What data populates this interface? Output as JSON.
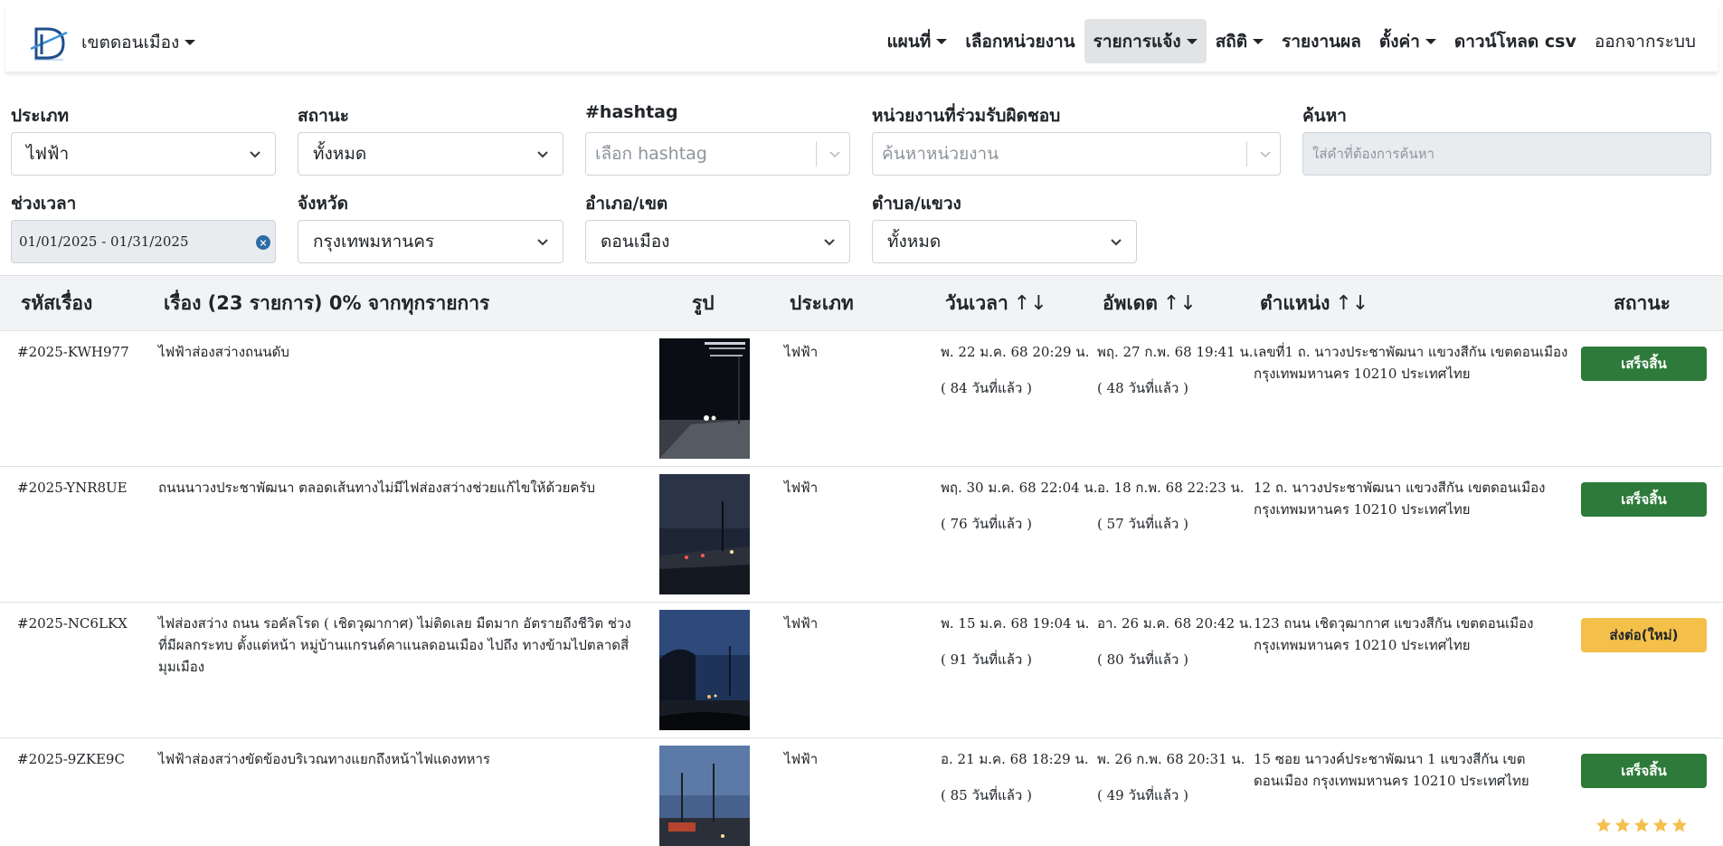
{
  "brand": {
    "district": "เขตดอนเมือง"
  },
  "nav": [
    {
      "label": "แผนที่",
      "dropdown": true,
      "active": false
    },
    {
      "label": "เลือกหน่วยงาน",
      "dropdown": false,
      "active": false
    },
    {
      "label": "รายการแจ้ง",
      "dropdown": true,
      "active": true
    },
    {
      "label": "สถิติ",
      "dropdown": true,
      "active": false
    },
    {
      "label": "รายงานผล",
      "dropdown": false,
      "active": false
    },
    {
      "label": "ตั้งค่า",
      "dropdown": true,
      "active": false
    },
    {
      "label": "ดาวน์โหลด csv",
      "dropdown": false,
      "active": false
    },
    {
      "label": "ออกจากระบบ",
      "dropdown": false,
      "active": false
    }
  ],
  "filters": {
    "type": {
      "label": "ประเภท",
      "value": "ไฟฟ้า"
    },
    "status": {
      "label": "สถานะ",
      "value": "ทั้งหมด"
    },
    "hashtag": {
      "label": "#hashtag",
      "placeholder": "เลือก hashtag"
    },
    "agency": {
      "label": "หน่วยงานที่ร่วมรับผิดชอบ",
      "placeholder": "ค้นหาหน่วยงาน"
    },
    "search": {
      "label": "ค้นหา",
      "placeholder": "ใส่คำที่ต้องการค้นหา"
    },
    "period": {
      "label": "ช่วงเวลา",
      "value": "01/01/2025 - 01/31/2025"
    },
    "province": {
      "label": "จังหวัด",
      "value": "กรุงเทพมหานคร"
    },
    "district": {
      "label": "อำเภอ/เขต",
      "value": "ดอนเมือง"
    },
    "subdistrict": {
      "label": "ตำบล/แขวง",
      "value": "ทั้งหมด"
    }
  },
  "table": {
    "headers": {
      "id": "รหัสเรื่อง",
      "title": "เรื่อง (23 รายการ) 0% จากทุกรายการ",
      "image": "รูป",
      "type": "ประเภท",
      "date": "วันเวลา",
      "updated": "อัพเดต",
      "location": "ตำแหน่ง",
      "status": "สถานะ"
    },
    "sort_icon": "↑↓",
    "rows": [
      {
        "id": "#2025-KWH977",
        "title": "ไฟฟ้าส่องสว่างถนนดับ",
        "type": "ไฟฟ้า",
        "date": "พ. 22 ม.ค. 68 20:29 น.",
        "date_ago": "( 84 วันที่แล้ว )",
        "updated": "พฤ. 27 ก.พ. 68 19:41 น.",
        "updated_ago": "( 48 วันที่แล้ว )",
        "location": "เลขที่1 ถ. นาวงประชาพัฒนา แขวงสีกัน เขตดอนเมือง กรุงเทพมหานคร 10210 ประเทศไทย",
        "status": "เสร็จสิ้น",
        "status_color": "#2d7a3a"
      },
      {
        "id": "#2025-YNR8UE",
        "title": "ถนนนาวงประชาพัฒนา ตลอดเส้นทางไม่มีไฟส่องสว่างช่วยแก้ไขให้ด้วยครับ",
        "type": "ไฟฟ้า",
        "date": "พฤ. 30 ม.ค. 68 22:04 น.",
        "date_ago": "( 76 วันที่แล้ว )",
        "updated": "อ. 18 ก.พ. 68 22:23 น.",
        "updated_ago": "( 57 วันที่แล้ว )",
        "location": "12 ถ. นาวงประชาพัฒนา แขวงสีกัน เขตดอนเมือง กรุงเทพมหานคร 10210 ประเทศไทย",
        "status": "เสร็จสิ้น",
        "status_color": "#2d7a3a"
      },
      {
        "id": "#2025-NC6LKX",
        "title": "ไฟส่องสว่าง ถนน รอคัลโรด ( เชิดวุฒากาศ) ไม่ติดเลย มืดมาก อัตรายถึงชีวิต ช่วงที่มีผลกระทบ ตั้งแต่หน้า หมู่บ้านแกรนด์คาแนลดอนเมือง ไปถึง ทางข้ามไปตลาดสี่มุมเมือง",
        "type": "ไฟฟ้า",
        "date": "พ. 15 ม.ค. 68 19:04 น.",
        "date_ago": "( 91 วันที่แล้ว )",
        "updated": "อา. 26 ม.ค. 68 20:42 น.",
        "updated_ago": "( 80 วันที่แล้ว )",
        "location": "123 ถนน เชิดวุฒากาศ แขวงสีกัน เขตดอนเมือง กรุงเทพมหานคร 10210 ประเทศไทย",
        "status": "ส่งต่อ(ใหม่)",
        "status_color": "#f4c04a"
      },
      {
        "id": "#2025-9ZKE9C",
        "title": "ไฟฟ้าส่องสว่างขัดข้องบริเวณทางแยกถึงหน้าไฟแดงทหาร",
        "type": "ไฟฟ้า",
        "date": "อ. 21 ม.ค. 68 18:29 น.",
        "date_ago": "( 85 วันที่แล้ว )",
        "updated": "พ. 26 ก.พ. 68 20:31 น.",
        "updated_ago": "( 49 วันที่แล้ว )",
        "location": "15 ซอย นาวงค์ประชาพัฒนา 1 แขวงสีกัน เขตดอนเมือง กรุงเทพมหานคร 10210 ประเทศไทย",
        "status": "เสร็จสิ้น",
        "status_color": "#2d7a3a",
        "rating": 5
      }
    ]
  }
}
